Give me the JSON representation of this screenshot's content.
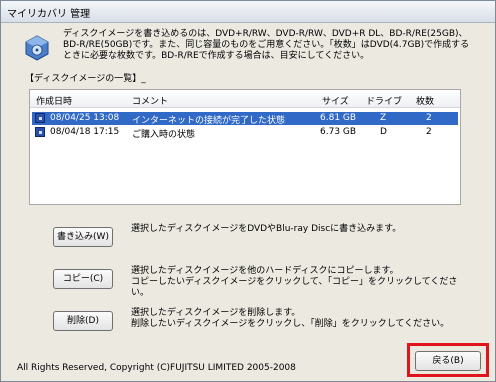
{
  "window": {
    "title": "マイリカバリ 管理"
  },
  "intro": {
    "line1": "ディスクイメージを書き込めるのは、DVD+R/RW、DVD-R/RW、DVD+R DL、BD-R/RE(25GB)、",
    "line2": "BD-R/RE(50GB)です。また、同じ容量のものをご用意ください。「枚数」はDVD(4.7GB)で作成する",
    "line3": "ときに必要な枚数です。BD-R/REで作成する場合は、目安にしてください。"
  },
  "section_label": "【ディスクイメージの一覧】_",
  "table": {
    "columns": [
      "作成日時",
      "コメント",
      "サイズ",
      "ドライブ",
      "枚数"
    ],
    "rows": [
      {
        "date": "08/04/25 13:08",
        "comment": "インターネットの接続が完了した状態",
        "size": "6.81 GB",
        "drive": "Z",
        "count": "2",
        "selected": true
      },
      {
        "date": "08/04/18 17:15",
        "comment": "ご購入時の状態",
        "size": "6.73 GB",
        "drive": "D",
        "count": "2",
        "selected": false
      }
    ]
  },
  "actions": {
    "write": {
      "label": "書き込み(W)",
      "desc1": "選択したディスクイメージをDVDやBlu-ray Discに書き込みます。",
      "desc2": ""
    },
    "copy": {
      "label": "コピー(C)",
      "desc1": "選択したディスクイメージを他のハードディスクにコピーします。",
      "desc2": "コピーしたいディスクイメージをクリックして、「コピー」をクリックしてください。"
    },
    "delete": {
      "label": "削除(D)",
      "desc1": "選択したディスクイメージを削除します。",
      "desc2": "削除したいディスクイメージをクリックし、「削除」をクリックしてください。"
    }
  },
  "footer": {
    "copyright": "All Rights Reserved, Copyright (C)FUJITSU LIMITED 2005-2008"
  },
  "back_button": {
    "label": "戻る(B)"
  },
  "colors": {
    "selection": "#3169c6",
    "highlight": "#e0141b"
  }
}
